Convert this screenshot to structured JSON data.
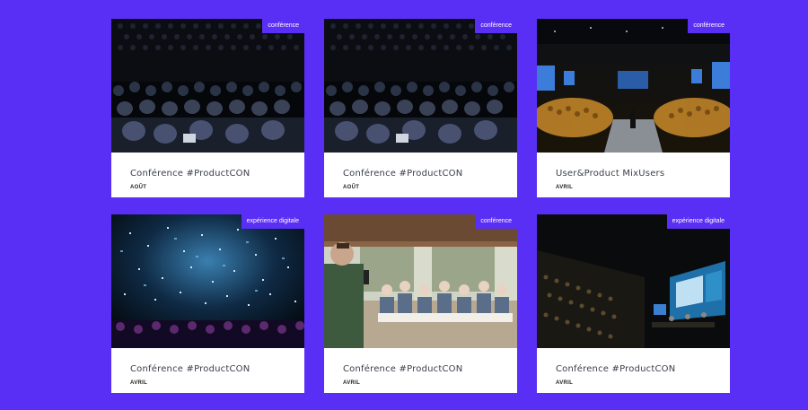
{
  "colors": {
    "background": "#5a2ff5",
    "tag": "#5a2ff5",
    "card": "#ffffff"
  },
  "cards": [
    {
      "tag": "conférence",
      "title": "Conférence #ProductCON",
      "month": "AOÛT"
    },
    {
      "tag": "conférence",
      "title": "Conférence #ProductCON",
      "month": "AOÛT"
    },
    {
      "tag": "conférence",
      "title": "User&Product MixUsers",
      "month": "AVRIL"
    },
    {
      "tag": "expérience digitale",
      "title": "Conférence #ProductCON",
      "month": "AVRIL"
    },
    {
      "tag": "conférence",
      "title": "Conférence #ProductCON",
      "month": "AVRIL"
    },
    {
      "tag": "expérience digitale",
      "title": "Conférence #ProductCON",
      "month": "AVRIL"
    }
  ]
}
